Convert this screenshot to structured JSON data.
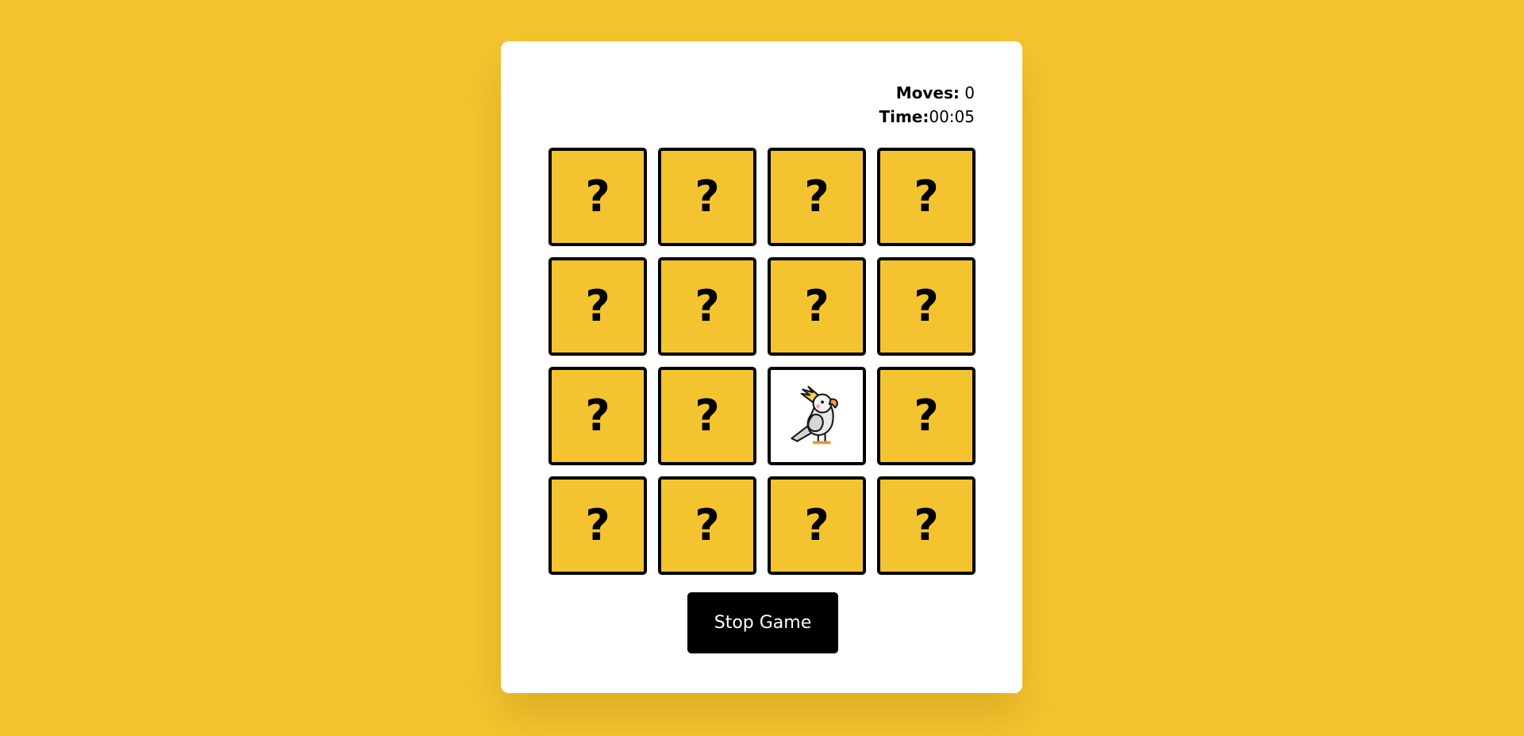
{
  "stats": {
    "moves_label": "Moves:",
    "moves_value": "0",
    "time_label": "Time:",
    "time_value": "00:05"
  },
  "card_back_symbol": "?",
  "grid": {
    "rows": 4,
    "columns": 4,
    "revealed_card": {
      "row": 3,
      "column": 3,
      "icon": "cockatoo-icon"
    }
  },
  "colors": {
    "background": "#f4c430",
    "card_back": "#f4c430",
    "panel": "#ffffff",
    "button": "#000000"
  },
  "buttons": {
    "stop_label": "Stop Game"
  }
}
